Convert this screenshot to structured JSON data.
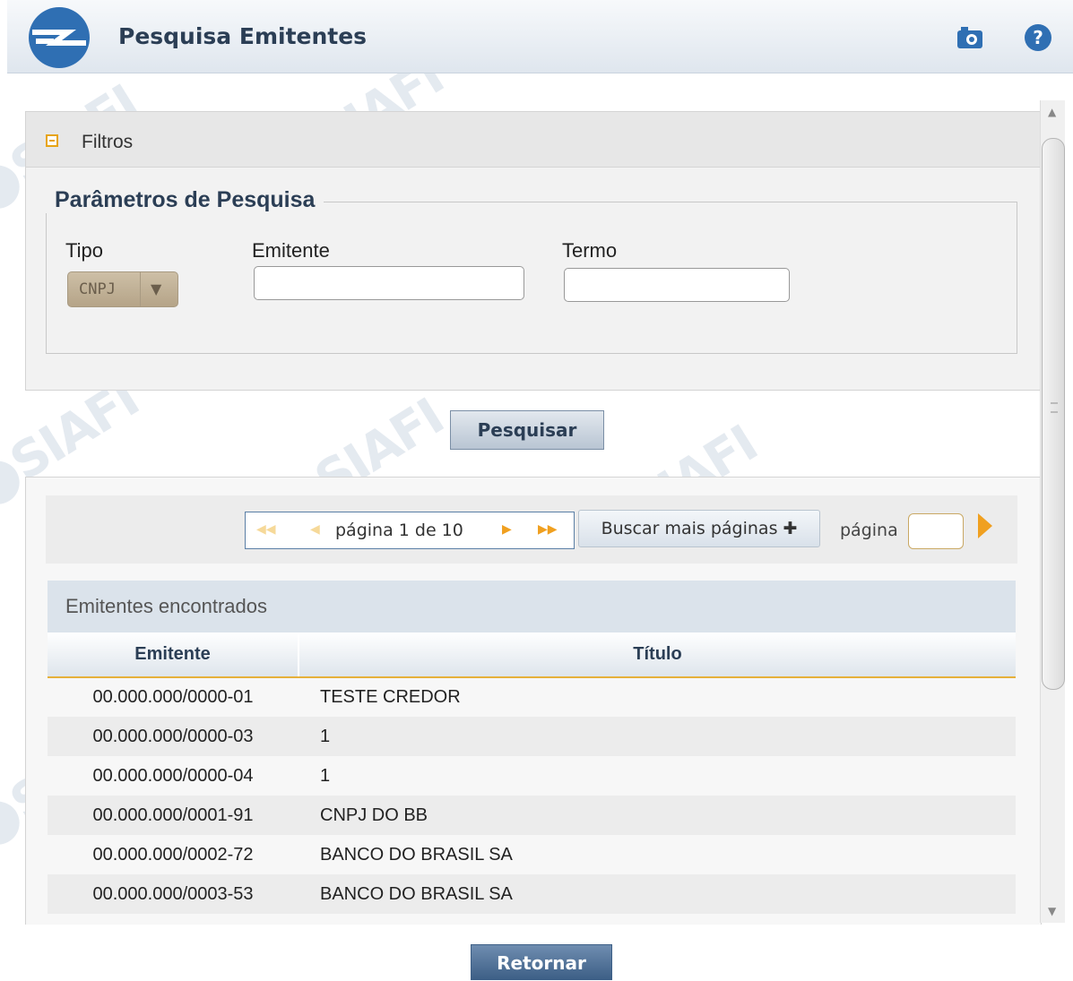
{
  "header": {
    "title": "Pesquisa Emitentes",
    "camera_icon": "camera-icon",
    "help_icon": "help-icon"
  },
  "watermark": {
    "text": "SIAFI"
  },
  "filter": {
    "section_label": "Filtros",
    "legend": "Parâmetros de Pesquisa",
    "tipo_label": "Tipo",
    "tipo_value": "CNPJ",
    "emitente_label": "Emitente",
    "emitente_value": "",
    "termo_label": "Termo",
    "termo_value": ""
  },
  "actions": {
    "search_label": "Pesquisar",
    "return_label": "Retornar"
  },
  "pager": {
    "page_text": "página 1 de 10",
    "more_pages_label": "Buscar mais páginas ✚",
    "goto_label": "página",
    "goto_value": ""
  },
  "results": {
    "caption": "Emitentes encontrados",
    "columns": [
      "Emitente",
      "Título"
    ],
    "rows": [
      [
        "00.000.000/0000-01",
        "TESTE CREDOR"
      ],
      [
        "00.000.000/0000-03",
        "1"
      ],
      [
        "00.000.000/0000-04",
        "1"
      ],
      [
        "00.000.000/0001-91",
        "CNPJ DO BB"
      ],
      [
        "00.000.000/0002-72",
        "BANCO DO BRASIL SA"
      ],
      [
        "00.000.000/0003-53",
        "BANCO DO BRASIL SA"
      ]
    ]
  },
  "colors": {
    "header_text": "#2b3e55",
    "accent_orange": "#f0a020",
    "return_button": "#3d5f86"
  }
}
